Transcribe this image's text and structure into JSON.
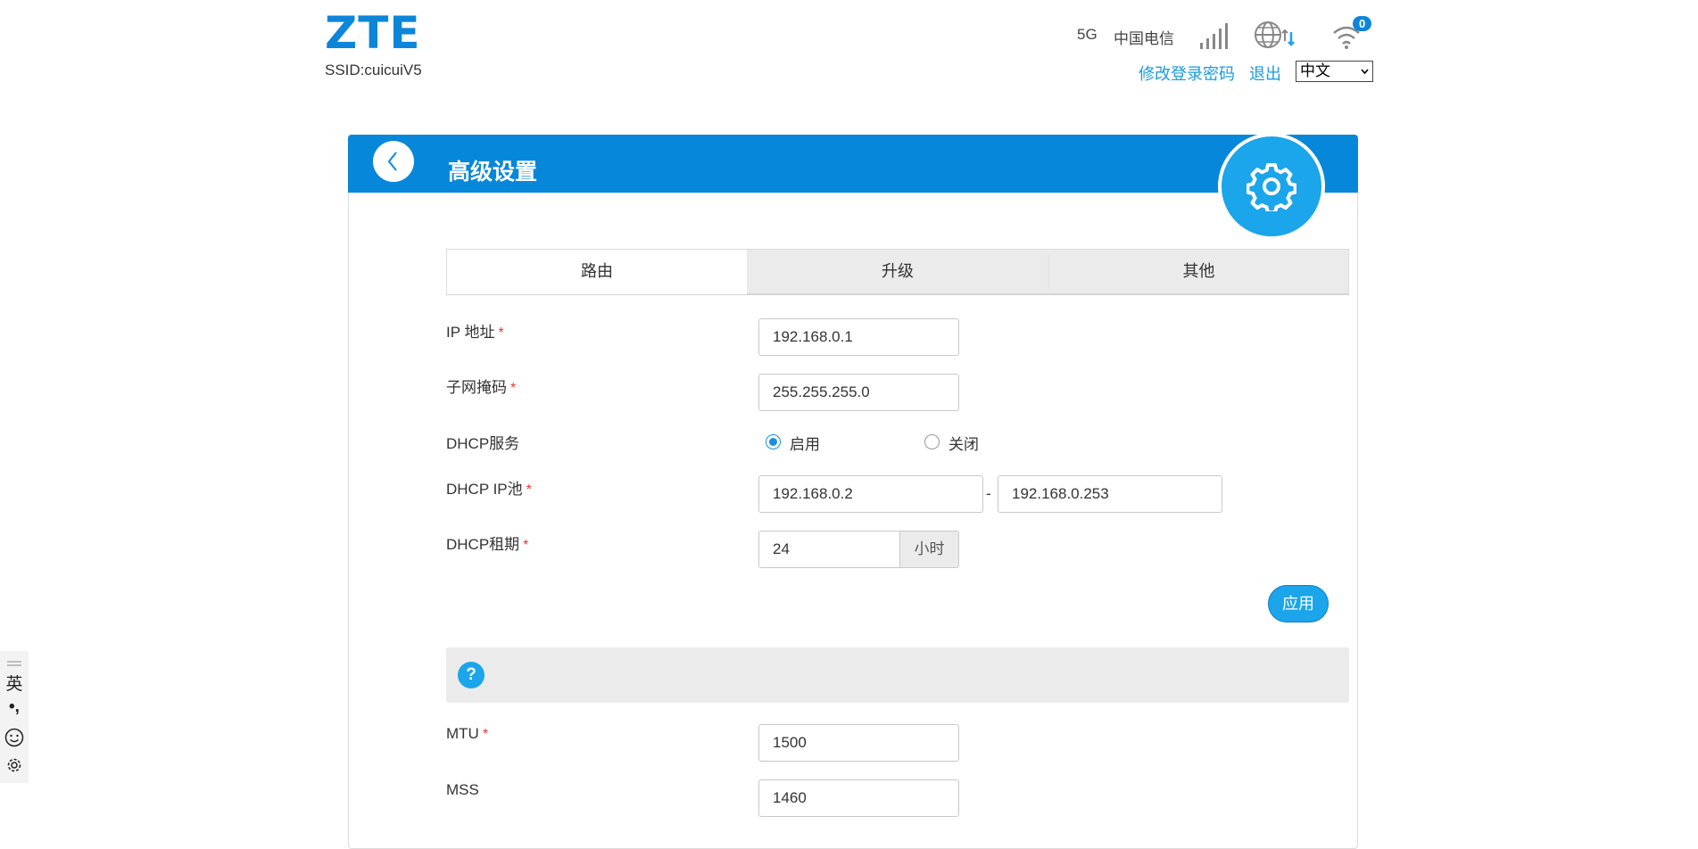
{
  "header": {
    "logo": "ZTE",
    "ssid": "SSID:cuicuiV5",
    "network_type": "5G",
    "carrier": "中国电信",
    "wifi_clients": "0",
    "change_password": "修改登录密码",
    "logout": "退出",
    "language": "中文",
    "icons": [
      "signal-icon",
      "globe-icon",
      "data-transfer-icon",
      "wifi-icon"
    ]
  },
  "panel": {
    "title": "高级设置",
    "tabs": [
      {
        "label": "路由",
        "active": true
      },
      {
        "label": "升级",
        "active": false
      },
      {
        "label": "其他",
        "active": false
      }
    ]
  },
  "form": {
    "ip_label": "IP 地址",
    "ip_value": "192.168.0.1",
    "mask_label": "子网掩码",
    "mask_value": "255.255.255.0",
    "dhcp_label": "DHCP服务",
    "dhcp_on": "启用",
    "dhcp_off": "关闭",
    "dhcp_selected": "启用",
    "pool_label": "DHCP IP池",
    "pool_start": "192.168.0.2",
    "pool_sep": "-",
    "pool_end": "192.168.0.253",
    "lease_label": "DHCP租期",
    "lease_value": "24",
    "lease_unit": "小时",
    "apply": "应用",
    "required_mark": "*"
  },
  "help": {
    "icon_text": "?"
  },
  "mtu_form": {
    "mtu_label": "MTU",
    "mtu_value": "1500",
    "mss_label": "MSS",
    "mss_value": "1460"
  },
  "ime": {
    "mode": "英",
    "punct": "•,",
    "icons": [
      "emoji-icon",
      "settings-icon"
    ]
  },
  "colors": {
    "primary": "#0787d9",
    "accent": "#1ba5ea",
    "link": "#1a9be0",
    "required": "#e33333"
  }
}
